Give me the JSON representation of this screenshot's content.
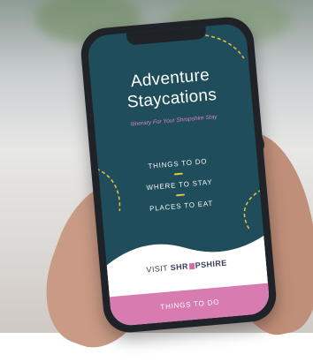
{
  "app": {
    "title_line1": "Adventure",
    "title_line2": "Staycations",
    "tagline": "Itinerary For Your Shropshire Stay",
    "menu": [
      {
        "label": "THINGS TO DO"
      },
      {
        "label": "WHERE TO STAY"
      },
      {
        "label": "PLACES TO EAT"
      }
    ],
    "brand": {
      "prefix": "VISIT",
      "name_part1": "SHR",
      "name_part2": "PSHIRE"
    },
    "cta_label": "THINGS TO DO"
  },
  "colors": {
    "screen_bg": "#1f4d5b",
    "accent_pink": "#d77bb0",
    "accent_yellow": "#e8c33b",
    "brand_text": "#3a3f5c"
  },
  "icons": {
    "brand_mark": "pink-square-icon",
    "decoration": "dashed-arc-icon"
  }
}
